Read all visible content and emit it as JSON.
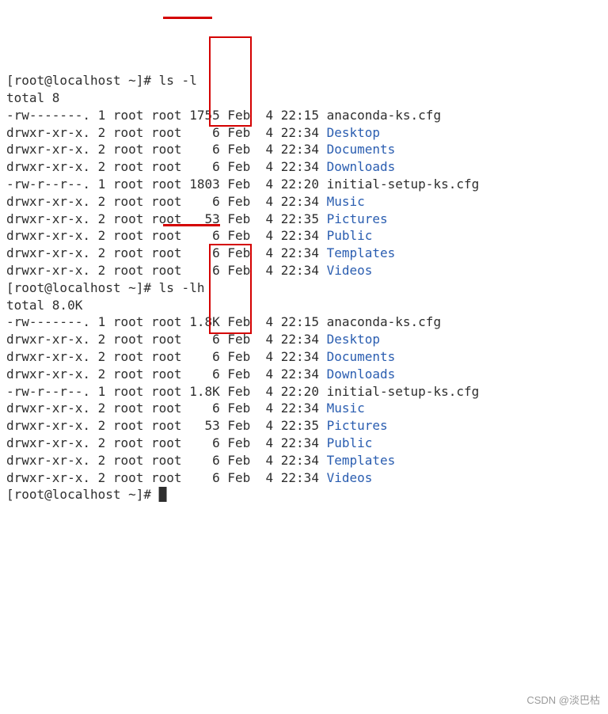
{
  "prompt": "[root@localhost ~]# ",
  "cmd1": "ls -l",
  "total1": "total 8",
  "cmd2": "ls -lh",
  "total2": "total 8.0K",
  "rows1": [
    {
      "perm": "-rw-------.",
      "links": "1",
      "owner": "root",
      "group": "root",
      "size": "1755",
      "month": "Feb",
      "day": "4",
      "time": "22:15",
      "name": "anaconda-ks.cfg",
      "dir": false
    },
    {
      "perm": "drwxr-xr-x.",
      "links": "2",
      "owner": "root",
      "group": "root",
      "size": "6",
      "month": "Feb",
      "day": "4",
      "time": "22:34",
      "name": "Desktop",
      "dir": true
    },
    {
      "perm": "drwxr-xr-x.",
      "links": "2",
      "owner": "root",
      "group": "root",
      "size": "6",
      "month": "Feb",
      "day": "4",
      "time": "22:34",
      "name": "Documents",
      "dir": true
    },
    {
      "perm": "drwxr-xr-x.",
      "links": "2",
      "owner": "root",
      "group": "root",
      "size": "6",
      "month": "Feb",
      "day": "4",
      "time": "22:34",
      "name": "Downloads",
      "dir": true
    },
    {
      "perm": "-rw-r--r--.",
      "links": "1",
      "owner": "root",
      "group": "root",
      "size": "1803",
      "month": "Feb",
      "day": "4",
      "time": "22:20",
      "name": "initial-setup-ks.cfg",
      "dir": false
    },
    {
      "perm": "drwxr-xr-x.",
      "links": "2",
      "owner": "root",
      "group": "root",
      "size": "6",
      "month": "Feb",
      "day": "4",
      "time": "22:34",
      "name": "Music",
      "dir": true
    },
    {
      "perm": "drwxr-xr-x.",
      "links": "2",
      "owner": "root",
      "group": "root",
      "size": "53",
      "month": "Feb",
      "day": "4",
      "time": "22:35",
      "name": "Pictures",
      "dir": true
    },
    {
      "perm": "drwxr-xr-x.",
      "links": "2",
      "owner": "root",
      "group": "root",
      "size": "6",
      "month": "Feb",
      "day": "4",
      "time": "22:34",
      "name": "Public",
      "dir": true
    },
    {
      "perm": "drwxr-xr-x.",
      "links": "2",
      "owner": "root",
      "group": "root",
      "size": "6",
      "month": "Feb",
      "day": "4",
      "time": "22:34",
      "name": "Templates",
      "dir": true
    },
    {
      "perm": "drwxr-xr-x.",
      "links": "2",
      "owner": "root",
      "group": "root",
      "size": "6",
      "month": "Feb",
      "day": "4",
      "time": "22:34",
      "name": "Videos",
      "dir": true
    }
  ],
  "rows2": [
    {
      "perm": "-rw-------.",
      "links": "1",
      "owner": "root",
      "group": "root",
      "size": "1.8K",
      "month": "Feb",
      "day": "4",
      "time": "22:15",
      "name": "anaconda-ks.cfg",
      "dir": false
    },
    {
      "perm": "drwxr-xr-x.",
      "links": "2",
      "owner": "root",
      "group": "root",
      "size": "6",
      "month": "Feb",
      "day": "4",
      "time": "22:34",
      "name": "Desktop",
      "dir": true
    },
    {
      "perm": "drwxr-xr-x.",
      "links": "2",
      "owner": "root",
      "group": "root",
      "size": "6",
      "month": "Feb",
      "day": "4",
      "time": "22:34",
      "name": "Documents",
      "dir": true
    },
    {
      "perm": "drwxr-xr-x.",
      "links": "2",
      "owner": "root",
      "group": "root",
      "size": "6",
      "month": "Feb",
      "day": "4",
      "time": "22:34",
      "name": "Downloads",
      "dir": true
    },
    {
      "perm": "-rw-r--r--.",
      "links": "1",
      "owner": "root",
      "group": "root",
      "size": "1.8K",
      "month": "Feb",
      "day": "4",
      "time": "22:20",
      "name": "initial-setup-ks.cfg",
      "dir": false
    },
    {
      "perm": "drwxr-xr-x.",
      "links": "2",
      "owner": "root",
      "group": "root",
      "size": "6",
      "month": "Feb",
      "day": "4",
      "time": "22:34",
      "name": "Music",
      "dir": true
    },
    {
      "perm": "drwxr-xr-x.",
      "links": "2",
      "owner": "root",
      "group": "root",
      "size": "53",
      "month": "Feb",
      "day": "4",
      "time": "22:35",
      "name": "Pictures",
      "dir": true
    },
    {
      "perm": "drwxr-xr-x.",
      "links": "2",
      "owner": "root",
      "group": "root",
      "size": "6",
      "month": "Feb",
      "day": "4",
      "time": "22:34",
      "name": "Public",
      "dir": true
    },
    {
      "perm": "drwxr-xr-x.",
      "links": "2",
      "owner": "root",
      "group": "root",
      "size": "6",
      "month": "Feb",
      "day": "4",
      "time": "22:34",
      "name": "Templates",
      "dir": true
    },
    {
      "perm": "drwxr-xr-x.",
      "links": "2",
      "owner": "root",
      "group": "root",
      "size": "6",
      "month": "Feb",
      "day": "4",
      "time": "22:34",
      "name": "Videos",
      "dir": true
    }
  ],
  "cursor": "█",
  "watermark": "CSDN @淡巴枯"
}
